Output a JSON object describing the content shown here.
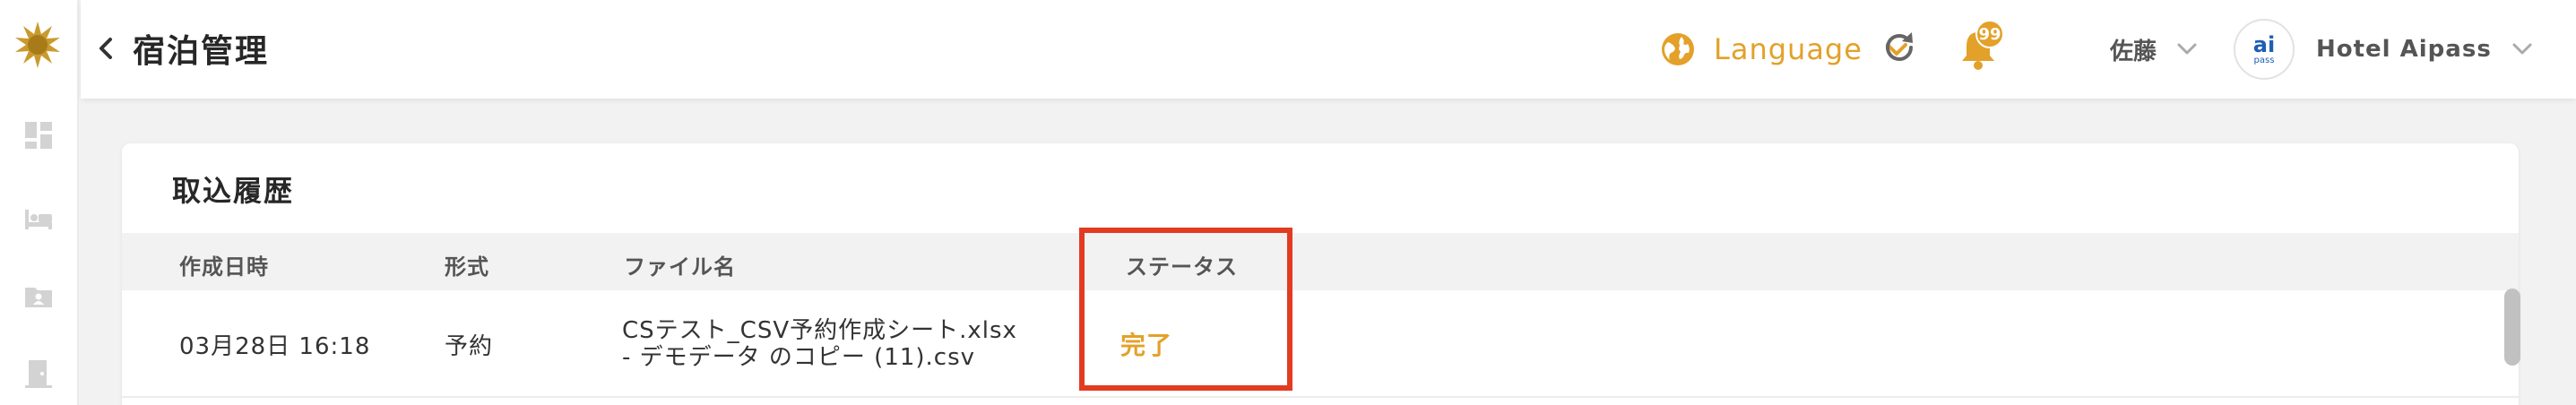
{
  "header": {
    "title": "宿泊管理",
    "language_label": "Language",
    "notification_count": "99",
    "user_name": "佐藤",
    "hotel_avatar_main": "ai",
    "hotel_avatar_sub": "pass",
    "hotel_name": "Hotel Aipass"
  },
  "card": {
    "title": "取込履歴",
    "columns": [
      "作成日時",
      "形式",
      "ファイル名",
      "ステータス"
    ],
    "rows": [
      {
        "created_at": "03月28日 16:18",
        "format": "予約",
        "file_name_line1": "CSテスト_CSV予約作成シート.xlsx",
        "file_name_line2": "- デモデータ のコピー (11).csv",
        "status": "完了"
      }
    ]
  },
  "colors": {
    "accent": "#e3a129",
    "highlight": "#e23b22",
    "header_bg": "#f2f2f2"
  },
  "icons": {
    "logo": "sun-logo-icon",
    "back": "chevron-left-icon",
    "globe": "globe-icon",
    "reload": "reload-icon",
    "bell": "bell-icon",
    "nav": [
      "dashboard-icon",
      "bed-icon",
      "folder-user-icon",
      "door-icon"
    ]
  }
}
